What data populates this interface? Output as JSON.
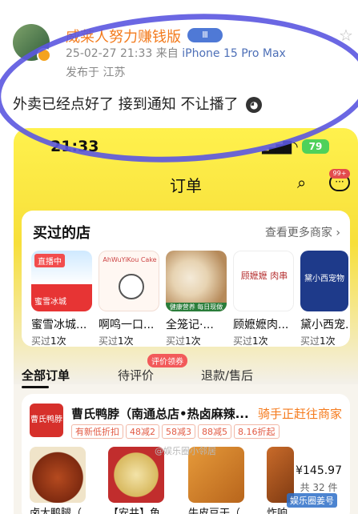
{
  "post": {
    "username": "威莱人努力赚钱版",
    "vip": "Ⅲ",
    "datetime": "25-02-27 21:33",
    "from_label": "来自",
    "device": "iPhone 15 Pro Max",
    "location": "发布于 江苏",
    "content": "外卖已经点好了 接到通知 不让播了",
    "emoji": "😶"
  },
  "phone": {
    "status": {
      "time": "21:33",
      "battery": "79"
    },
    "header": {
      "title": "订单",
      "more_badge": "99+"
    },
    "stores": {
      "title": "买过的店",
      "more": "查看更多商家 ›",
      "items": [
        {
          "name": "蜜雪冰城...",
          "bought": "买过",
          "count": "1次",
          "badge": "直播中",
          "logo_text": "蜜雪冰城"
        },
        {
          "name": "啊鸣一口...",
          "bought": "买过",
          "count": "1次",
          "logo_text": "AhWuYiKou Cake"
        },
        {
          "name": "全笼记·...",
          "bought": "买过",
          "count": "1次",
          "logo_text": "健康营养 每日现做"
        },
        {
          "name": "顾嬷嬷肉...",
          "bought": "买过",
          "count": "1次",
          "logo_text": "顾嬷嬷 肉串"
        },
        {
          "name": "黛小西宠...",
          "bought": "买过",
          "count": "1次",
          "logo_text": "黛小西宠物"
        }
      ]
    },
    "tabs": [
      {
        "label": "全部订单"
      },
      {
        "label": "待评价"
      },
      {
        "label": "退款/售后"
      }
    ],
    "coupon": "评价领券",
    "order": {
      "logo": "曹氏鸭脖",
      "shop": "曹氏鸭脖（南通总店•热卤麻辣...",
      "status": "骑手正赶往商家",
      "tags": [
        "有新低折扣",
        "48减2",
        "58减3",
        "88减5",
        "8.16折起"
      ],
      "items": [
        {
          "name": "卤大鸭腿（..."
        },
        {
          "name": "【安井】鱼..."
        },
        {
          "name": "牛皮豆干（..."
        },
        {
          "name": "炸响..."
        }
      ],
      "price": "¥145.97",
      "count": "共 32 件"
    },
    "watermark": "@娱乐圈小邻居"
  },
  "footer_brand": "娱乐圈姜号"
}
